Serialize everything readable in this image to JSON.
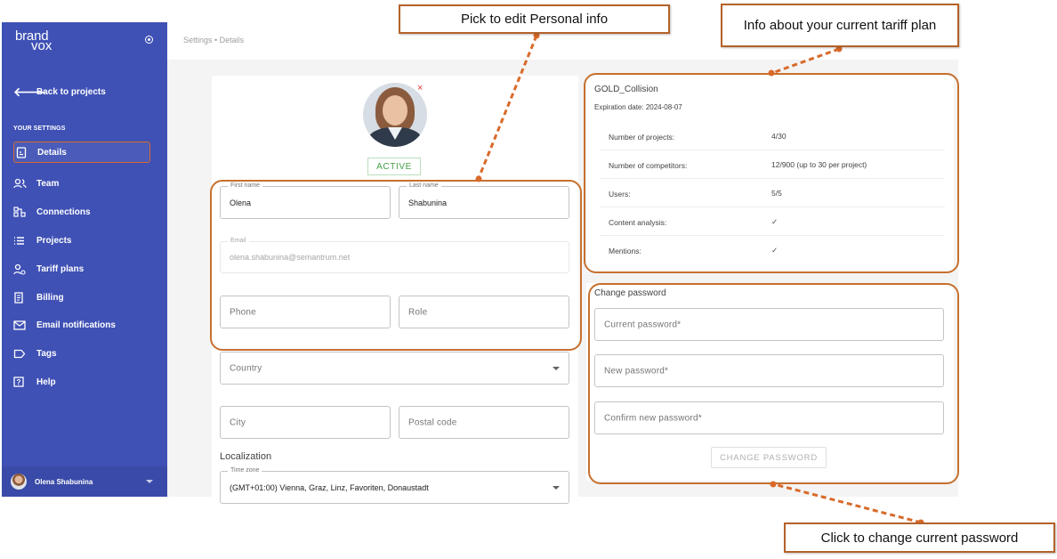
{
  "brand": {
    "line1": "brand",
    "line2": "vox"
  },
  "sidebar": {
    "back_label": "Back to projects",
    "section_label": "YOUR SETTINGS",
    "items": [
      {
        "label": "Details",
        "icon": "details-doc-icon",
        "active": true
      },
      {
        "label": "Team",
        "icon": "team-icon"
      },
      {
        "label": "Connections",
        "icon": "connections-icon"
      },
      {
        "label": "Projects",
        "icon": "list-icon"
      },
      {
        "label": "Tariff plans",
        "icon": "tariff-person-icon"
      },
      {
        "label": "Billing",
        "icon": "billing-icon"
      },
      {
        "label": "Email notifications",
        "icon": "mail-icon"
      },
      {
        "label": "Tags",
        "icon": "tag-icon"
      },
      {
        "label": "Help",
        "icon": "help-icon"
      }
    ],
    "user_name": "Olena Shabunina"
  },
  "breadcrumb": "Settings • Details",
  "profile": {
    "remove_glyph": "×",
    "status": "ACTIVE",
    "first_name_label": "First name",
    "first_name": "Olena",
    "last_name_label": "Last name",
    "last_name": "Shabunina",
    "email_label": "Email",
    "email": "olena.shabunina@semantrum.net",
    "phone_placeholder": "Phone",
    "role_placeholder": "Role",
    "country_placeholder": "Country",
    "city_placeholder": "City",
    "postal_placeholder": "Postal code",
    "localization_title": "Localization",
    "timezone_label": "Time zone",
    "timezone": "(GMT+01:00) Vienna, Graz, Linz, Favoriten, Donaustadt"
  },
  "tariff": {
    "name": "GOLD_Collision",
    "expiration": "Expiration date:  2024-08-07",
    "rows": [
      {
        "key": "Number of projects:",
        "value": "4/30"
      },
      {
        "key": "Number of competitors:",
        "value": "12/900 (up to 30 per project)"
      },
      {
        "key": "Users:",
        "value": "5/5"
      },
      {
        "key": "Content analysis:",
        "value": "✓"
      },
      {
        "key": "Mentions:",
        "value": "✓"
      }
    ]
  },
  "password": {
    "title": "Change password",
    "current_placeholder": "Current password*",
    "new_placeholder": "New password*",
    "confirm_placeholder": "Confirm new password*",
    "button": "CHANGE PASSWORD"
  },
  "annotations": {
    "personal": "Pick to edit Personal info",
    "tariff": "Info about your current  tariff plan",
    "password": "Click to change current password"
  },
  "colors": {
    "sidebar": "#3f51b5",
    "annotation": "#c7702f",
    "active_status": "#43a047"
  }
}
